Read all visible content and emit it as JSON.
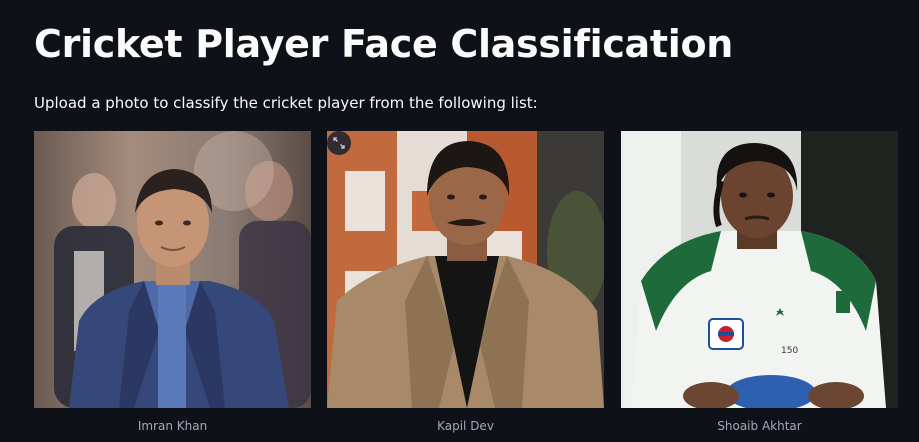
{
  "page": {
    "title": "Cricket Player Face Classification",
    "subtitle": "Upload a photo to classify the cricket player from the following list:"
  },
  "players": [
    {
      "name": "Imran Khan",
      "image_desc": "man in blue suit",
      "icon": "person-photo"
    },
    {
      "name": "Kapil Dev",
      "image_desc": "man in beige jacket",
      "icon": "person-photo"
    },
    {
      "name": "Shoaib Akhtar",
      "image_desc": "man in cricket jersey",
      "icon": "person-photo"
    }
  ],
  "controls": {
    "fullscreen_icon": "expand-icon"
  },
  "colors": {
    "background": "#0e1117",
    "text": "#fafafa",
    "caption": "#a3a8b8",
    "button_bg": "#262730"
  }
}
